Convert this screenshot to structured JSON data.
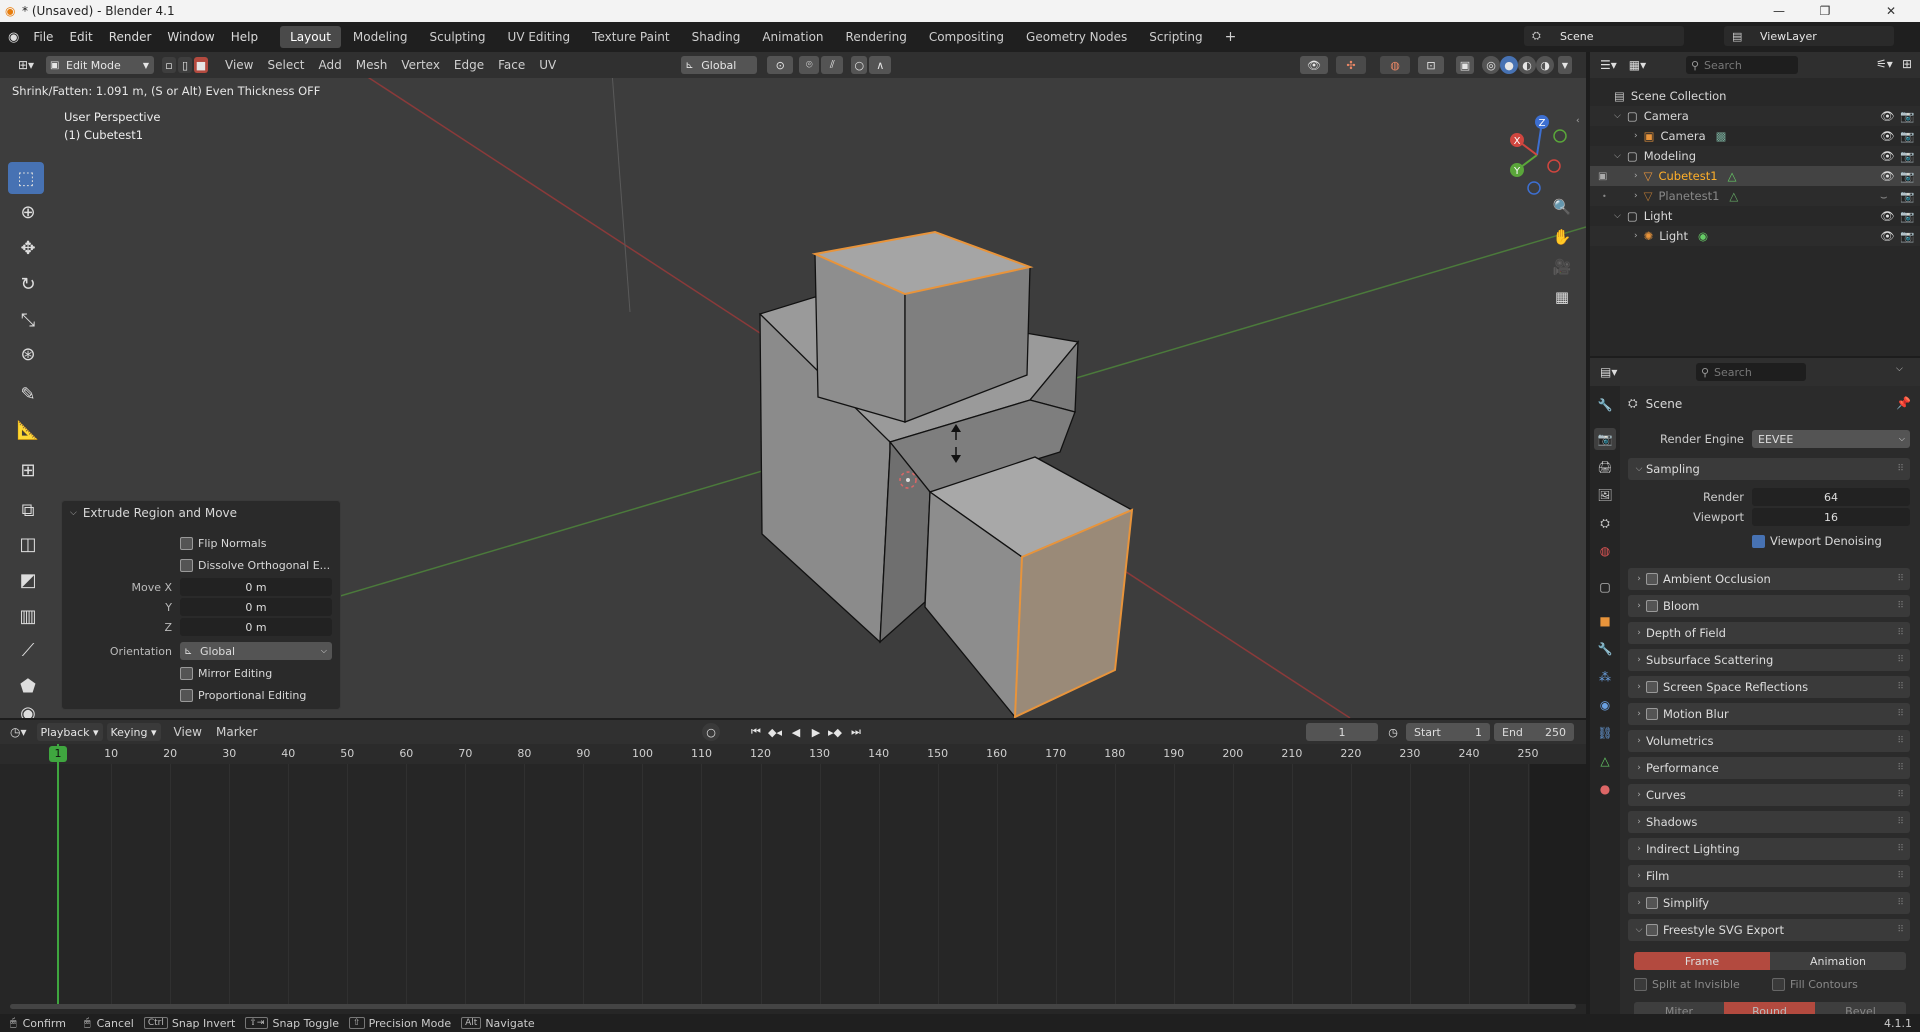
{
  "window": {
    "title": "* (Unsaved) - Blender 4.1"
  },
  "menus": [
    "File",
    "Edit",
    "Render",
    "Window",
    "Help"
  ],
  "workspaces": [
    "Layout",
    "Modeling",
    "Sculpting",
    "UV Editing",
    "Texture Paint",
    "Shading",
    "Animation",
    "Rendering",
    "Compositing",
    "Geometry Nodes",
    "Scripting"
  ],
  "topright": {
    "scene": "Scene",
    "view_layer": "ViewLayer"
  },
  "viewport_header": {
    "mode": "Edit Mode",
    "menus": [
      "View",
      "Select",
      "Add",
      "Mesh",
      "Vertex",
      "Edge",
      "Face",
      "UV"
    ],
    "orientation": "Global"
  },
  "viewport": {
    "status_text": "Shrink/Fatten: 1.091 m, (S or Alt) Even Thickness OFF",
    "view_name": "User Perspective",
    "object_name": "(1) Cubetest1",
    "gizmo": {
      "x": "X",
      "y": "Y",
      "z": "Z"
    }
  },
  "operator_panel": {
    "title": "Extrude Region and Move",
    "flip_normals": "Flip Normals",
    "dissolve": "Dissolve Orthogonal E...",
    "move_x_label": "Move X",
    "y_label": "Y",
    "z_label": "Z",
    "move_x": "0 m",
    "move_y": "0 m",
    "move_z": "0 m",
    "orientation_label": "Orientation",
    "orientation": "Global",
    "mirror": "Mirror Editing",
    "proportional": "Proportional Editing"
  },
  "timeline": {
    "menus": [
      "Playback",
      "Keying",
      "View",
      "Marker"
    ],
    "current_frame": "1",
    "start_label": "Start",
    "start": "1",
    "end_label": "End",
    "end": "250",
    "ticks": [
      "1",
      "10",
      "20",
      "30",
      "40",
      "50",
      "60",
      "70",
      "80",
      "90",
      "100",
      "110",
      "120",
      "130",
      "140",
      "150",
      "160",
      "170",
      "180",
      "190",
      "200",
      "210",
      "220",
      "230",
      "240",
      "250"
    ]
  },
  "outliner": {
    "search_placeholder": "Search",
    "root": "Scene Collection",
    "rows": [
      {
        "label": "Camera",
        "type": "collection"
      },
      {
        "label": "Camera",
        "type": "object"
      },
      {
        "label": "Modeling",
        "type": "collection"
      },
      {
        "label": "Cubetest1",
        "type": "object"
      },
      {
        "label": "Planetest1",
        "type": "object"
      },
      {
        "label": "Light",
        "type": "collection"
      },
      {
        "label": "Light",
        "type": "object"
      }
    ]
  },
  "properties": {
    "search_placeholder": "Search",
    "context": "Scene",
    "render_engine_label": "Render Engine",
    "render_engine": "EEVEE",
    "sampling": "Sampling",
    "render_label": "Render",
    "render_samples": "64",
    "viewport_label": "Viewport",
    "viewport_samples": "16",
    "viewport_denoising": "Viewport Denoising",
    "sections": [
      "Ambient Occlusion",
      "Bloom",
      "Depth of Field",
      "Subsurface Scattering",
      "Screen Space Reflections",
      "Motion Blur",
      "Volumetrics",
      "Performance",
      "Curves",
      "Shadows",
      "Indirect Lighting",
      "Film",
      "Simplify",
      "Freestyle SVG Export"
    ],
    "freestyle_tabs": [
      "Frame",
      "Animation"
    ],
    "split_invisible": "Split at Invisible",
    "fill_contours": "Fill Contours",
    "line_join": [
      "Miter",
      "Round",
      "Bevel"
    ]
  },
  "statusbar": {
    "items": [
      "Confirm",
      "Cancel",
      "Snap Invert",
      "Snap Toggle",
      "Precision Mode",
      "Navigate"
    ],
    "keys": [
      "Ctrl",
      "Alt"
    ],
    "version": "4.1.1"
  },
  "colors": {
    "accent_blue": "#4772b3",
    "selection_orange": "#e8943b",
    "active_red": "#b34a3f"
  }
}
